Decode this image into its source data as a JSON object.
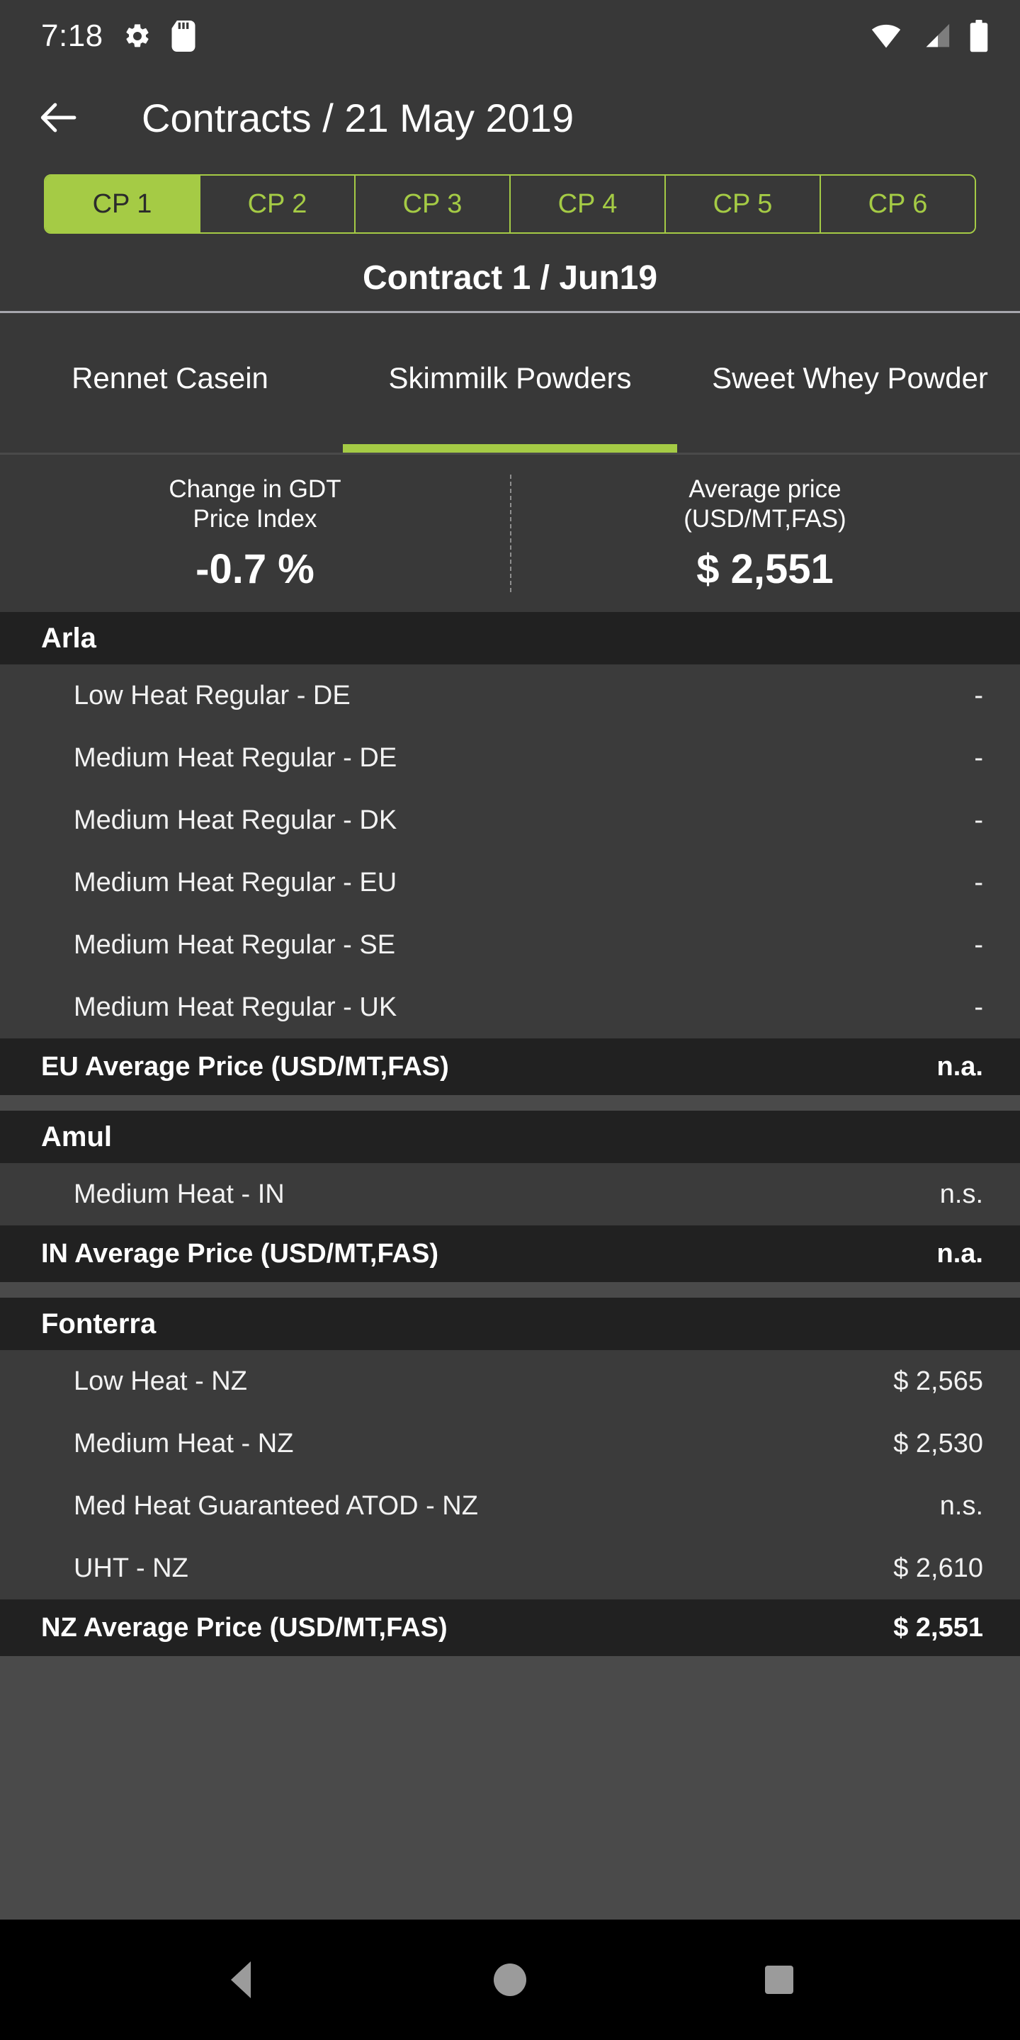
{
  "status_bar": {
    "time": "7:18",
    "icons_left": [
      "gear-icon",
      "sd-card-icon"
    ],
    "icons_right": [
      "wifi-icon",
      "cellular-signal-icon",
      "battery-icon"
    ]
  },
  "app_bar": {
    "back_icon": "back-arrow-icon",
    "title": "Contracts / 21 May 2019"
  },
  "contract_periods": {
    "selected": "CP 1",
    "items": [
      {
        "label": "CP 1",
        "active": true
      },
      {
        "label": "CP 2",
        "active": false
      },
      {
        "label": "CP 3",
        "active": false
      },
      {
        "label": "CP 4",
        "active": false
      },
      {
        "label": "CP 5",
        "active": false
      },
      {
        "label": "CP 6",
        "active": false
      }
    ]
  },
  "subtitle": "Contract 1 / Jun19",
  "product_tabs": {
    "selected": "Skimmilk Powders",
    "items": [
      {
        "label": "Rennet Casein",
        "active": false
      },
      {
        "label": "Skimmilk Powders",
        "active": true
      },
      {
        "label": "Sweet Whey Powder",
        "active": false
      }
    ]
  },
  "stats": [
    {
      "label": "Change in GDT\nPrice Index",
      "value": "-0.7 %"
    },
    {
      "label": "Average price\n(USD/MT,FAS)",
      "value": "$ 2,551"
    }
  ],
  "groups": [
    {
      "name": "Arla",
      "rows": [
        {
          "label": "Low Heat Regular - DE",
          "value": "-"
        },
        {
          "label": "Medium Heat Regular - DE",
          "value": "-"
        },
        {
          "label": "Medium Heat Regular - DK",
          "value": "-"
        },
        {
          "label": "Medium Heat Regular - EU",
          "value": "-"
        },
        {
          "label": "Medium Heat Regular - SE",
          "value": "-"
        },
        {
          "label": "Medium Heat Regular - UK",
          "value": "-"
        }
      ],
      "footer": {
        "label": "EU Average Price (USD/MT,FAS)",
        "value": "n.a."
      }
    },
    {
      "name": "Amul",
      "rows": [
        {
          "label": "Medium Heat - IN",
          "value": "n.s."
        }
      ],
      "footer": {
        "label": "IN Average Price (USD/MT,FAS)",
        "value": "n.a."
      }
    },
    {
      "name": "Fonterra",
      "rows": [
        {
          "label": "Low Heat - NZ",
          "value": "$ 2,565"
        },
        {
          "label": "Medium Heat - NZ",
          "value": "$ 2,530"
        },
        {
          "label": "Med Heat Guaranteed ATOD - NZ",
          "value": "n.s."
        },
        {
          "label": "UHT - NZ",
          "value": "$ 2,610"
        }
      ],
      "footer": {
        "label": "NZ Average Price (USD/MT,FAS)",
        "value": "$ 2,551"
      }
    }
  ],
  "nav_bar": {
    "back": "nav-back-icon",
    "home": "nav-home-icon",
    "recents": "nav-recents-icon"
  },
  "colors": {
    "accent_green": "#a5cb45",
    "app_background": "#383838",
    "row_background": "#3b3b3b",
    "group_header_background": "#212121"
  }
}
